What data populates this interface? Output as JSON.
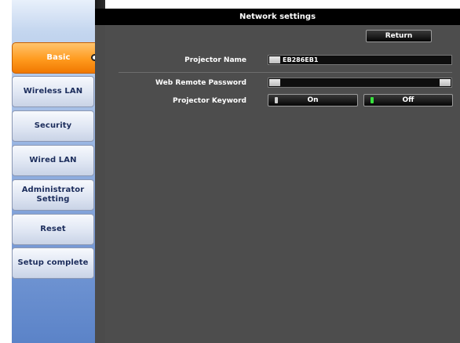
{
  "window": {
    "title": "Network settings"
  },
  "sidebar": {
    "items": [
      {
        "label": "Basic",
        "active": true
      },
      {
        "label": "Wireless LAN",
        "active": false
      },
      {
        "label": "Security",
        "active": false
      },
      {
        "label": "Wired LAN",
        "active": false
      },
      {
        "label": "Administrator\nSetting",
        "active": false
      },
      {
        "label": "Reset",
        "active": false
      },
      {
        "label": "Setup complete",
        "active": false
      }
    ]
  },
  "toolbar": {
    "return_label": "Return"
  },
  "form": {
    "projector_name": {
      "label": "Projector Name",
      "value": "EB286EB1"
    },
    "web_remote_password": {
      "label": "Web Remote Password",
      "value": ""
    },
    "projector_keyword": {
      "label": "Projector Keyword",
      "options": [
        "On",
        "Off"
      ],
      "selected": "Off"
    }
  },
  "colors": {
    "active_tab": "#ff9a1e",
    "panel_bg": "#4b4b4b",
    "title_bar": "#000000",
    "selected_indicator": "#37e03d"
  },
  "icons": {
    "active_marker": "chevron-right-circle-icon",
    "radio_indicator": "radio-indicator-icon"
  }
}
